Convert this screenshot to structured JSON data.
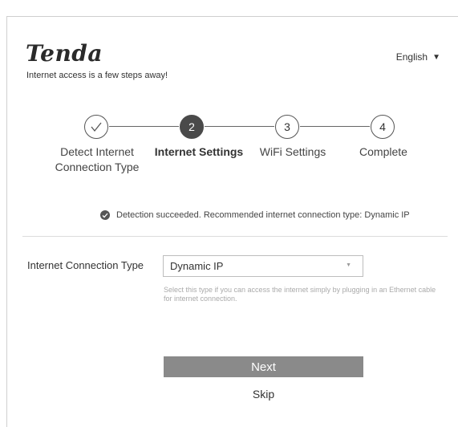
{
  "brand": {
    "logo": "Tenda",
    "tagline": "Internet access is a few steps away!"
  },
  "language": {
    "selected": "English",
    "caret": "▼"
  },
  "steps": [
    {
      "number": "",
      "label": "Detect Internet Connection Type",
      "state": "done"
    },
    {
      "number": "2",
      "label": "Internet Settings",
      "state": "active"
    },
    {
      "number": "3",
      "label": "WiFi Settings",
      "state": "pending"
    },
    {
      "number": "4",
      "label": "Complete",
      "state": "pending"
    }
  ],
  "detection": {
    "message": "Detection succeeded. Recommended internet connection type: Dynamic IP"
  },
  "connection": {
    "label": "Internet Connection Type",
    "selected": "Dynamic IP",
    "hint": "Select this type if you can access the internet simply by plugging in an Ethernet cable for internet connection."
  },
  "actions": {
    "next_label": "Next",
    "skip_label": "Skip"
  },
  "colors": {
    "active_step": "#4a4a4a",
    "button": "#8a8a8a",
    "divider": "#dcdcdc",
    "hint_text": "#aaaaaa"
  }
}
